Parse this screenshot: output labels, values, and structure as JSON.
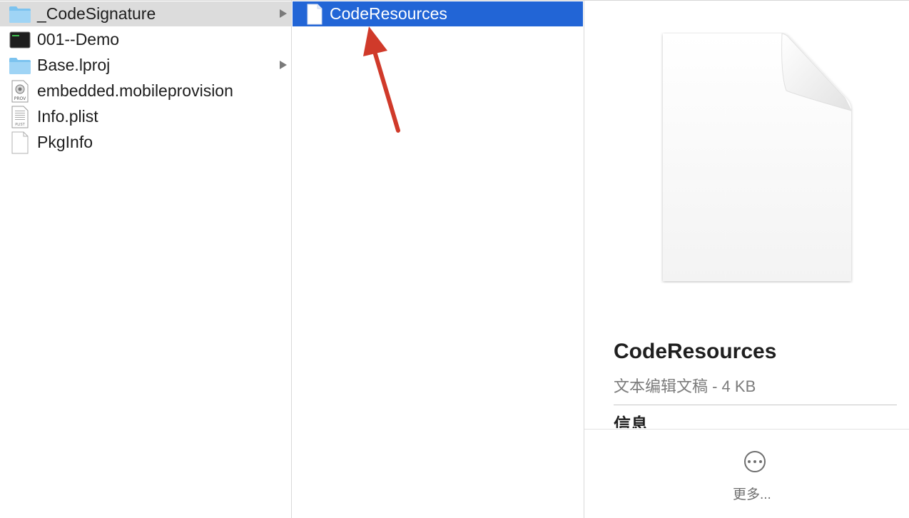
{
  "column1": {
    "items": [
      {
        "label": "_CodeSignature",
        "icon": "folder-icon",
        "has_children": true
      },
      {
        "label": "001--Demo",
        "icon": "terminal-exec-icon",
        "has_children": false
      },
      {
        "label": "Base.lproj",
        "icon": "folder-icon",
        "has_children": true
      },
      {
        "label": "embedded.mobileprovision",
        "icon": "provisioning-profile-icon",
        "icon_text": "PROV",
        "has_children": false
      },
      {
        "label": "Info.plist",
        "icon": "plist-document-icon",
        "icon_text": "PLIST",
        "has_children": false
      },
      {
        "label": "PkgInfo",
        "icon": "blank-document-icon",
        "has_children": false
      }
    ]
  },
  "column2": {
    "items": [
      {
        "label": "CodeResources",
        "icon": "blank-document-icon",
        "selected": true
      }
    ]
  },
  "preview": {
    "name": "CodeResources",
    "kind": "文本编辑文稿 - 4 KB",
    "info_heading": "信息",
    "more_label": "更多..."
  },
  "colors": {
    "selection": "#2265d6",
    "inactive_selection": "#dcdcdc",
    "annotation_arrow": "#d03a2a",
    "folder": "#7cc3ef"
  }
}
